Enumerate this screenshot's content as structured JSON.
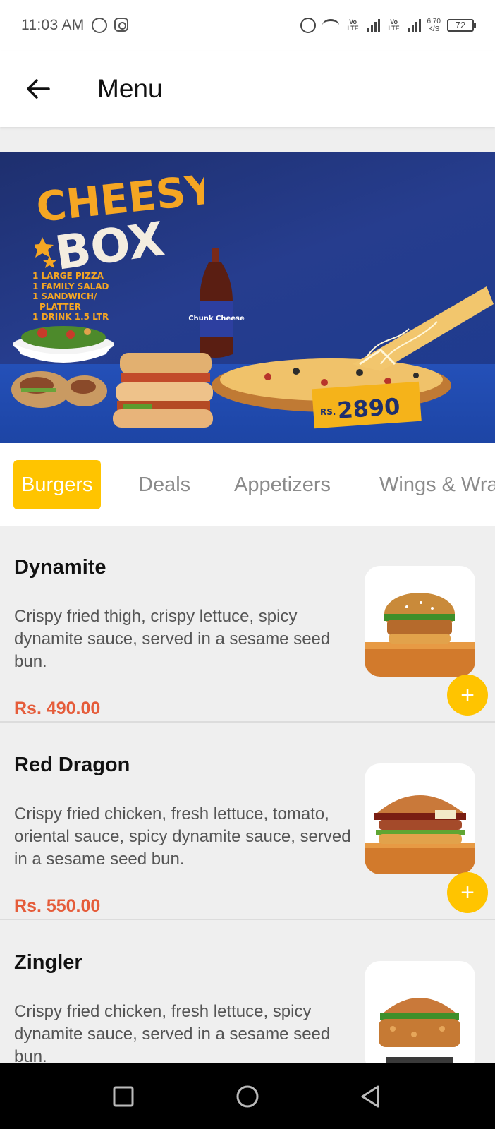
{
  "status_bar": {
    "time": "11:03 AM",
    "net_tag_1": "Vo LTE",
    "net_tag_2": "Vo LTE",
    "speed_value": "6.70",
    "speed_unit": "K/S",
    "battery": "72"
  },
  "app_bar": {
    "title": "Menu"
  },
  "banner": {
    "brand_line1": "CHEESY",
    "brand_line2": "BOX",
    "lines": [
      "1 LARGE PIZZA",
      "1 FAMILY SALAD",
      "1 SANDWICH/",
      "PLATTER",
      "1 DRINK 1.5 LTR"
    ],
    "bottle_label": "Chunk Cheese",
    "price_prefix": "RS.",
    "price": "2890"
  },
  "tabs": [
    {
      "label": "Burgers",
      "active": true
    },
    {
      "label": "Deals",
      "active": false
    },
    {
      "label": "Appetizers",
      "active": false
    },
    {
      "label": "Wings & Wraps",
      "active": false
    }
  ],
  "menu_items": [
    {
      "name": "Dynamite",
      "description": "Crispy fried thigh, crispy lettuce, spicy dynamite sauce, served in a sesame seed bun.",
      "price": "Rs. 490.00",
      "add_label": "+"
    },
    {
      "name": "Red Dragon",
      "description": "Crispy fried chicken, fresh lettuce, tomato, oriental sauce, spicy dynamite sauce, served in a sesame seed bun.",
      "price": "Rs. 550.00",
      "add_label": "+"
    },
    {
      "name": "Zingler",
      "description": "Crispy fried chicken, fresh lettuce, spicy dynamite sauce, served in a sesame seed bun.",
      "price": "",
      "add_label": "+"
    }
  ],
  "colors": {
    "accent": "#ffc400",
    "price": "#e55c3a",
    "banner_bg": "#1e2f6e"
  },
  "icons": {
    "back": "arrow-left-icon",
    "nav_recents": "square-icon",
    "nav_home": "circle-icon",
    "nav_back": "triangle-back-icon"
  }
}
